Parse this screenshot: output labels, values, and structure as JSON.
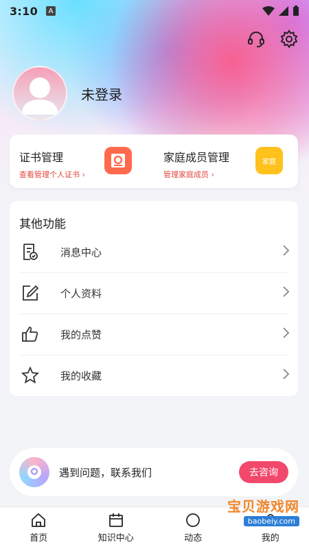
{
  "status": {
    "time": "3:10",
    "app_badge": "A"
  },
  "profile": {
    "name": "未登录"
  },
  "top_cards": [
    {
      "title": "证书管理",
      "subtitle": "查看管理个人证书 ›"
    },
    {
      "title": "家庭成员管理",
      "subtitle": "管理家庭成员 ›",
      "badge": "家庭"
    }
  ],
  "other": {
    "title": "其他功能",
    "items": [
      {
        "label": "消息中心",
        "icon": "message-doc-icon"
      },
      {
        "label": "个人资料",
        "icon": "edit-icon"
      },
      {
        "label": "我的点赞",
        "icon": "thumbs-up-icon"
      },
      {
        "label": "我的收藏",
        "icon": "star-icon"
      }
    ]
  },
  "help": {
    "text": "遇到问题，联系我们",
    "button": "去咨询"
  },
  "tabs": [
    {
      "label": "首页",
      "icon": "home-icon"
    },
    {
      "label": "知识中心",
      "icon": "calendar-icon"
    },
    {
      "label": "动态",
      "icon": "dynamic-icon"
    },
    {
      "label": "我的",
      "icon": "user-icon"
    }
  ],
  "watermark": {
    "title": "宝贝游戏网",
    "url": "baobeiy.com"
  },
  "colors": {
    "accent": "#f2486b",
    "link_red": "#e2473c",
    "cert": "#ff6a4d",
    "family": "#ffc21d"
  }
}
